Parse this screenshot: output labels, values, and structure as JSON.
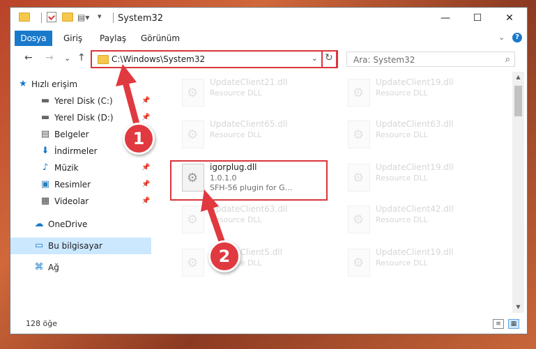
{
  "window": {
    "title": "System32",
    "controls": {
      "minimize": "—",
      "maximize": "☐",
      "close": "✕"
    }
  },
  "ribbon": {
    "tabs": [
      "Dosya",
      "Giriş",
      "Paylaş",
      "Görünüm"
    ],
    "expand": "⌄",
    "help": "?"
  },
  "nav": {
    "back": "←",
    "forward": "→",
    "recent": "⌄",
    "up": "↑",
    "address": "C:\\Windows\\System32",
    "address_dropdown": "⌄",
    "refresh": "↻",
    "search_placeholder": "Ara: System32",
    "search_glyph": "⌕"
  },
  "sidebar": {
    "items": [
      {
        "label": "Hızlı erişim",
        "icon": "star-icon",
        "glyph": "★",
        "pinned": false
      },
      {
        "label": "Yerel Disk (C:)",
        "icon": "drive-icon",
        "glyph": "▬",
        "pinned": true
      },
      {
        "label": "Yerel Disk (D:)",
        "icon": "drive-icon",
        "glyph": "▬",
        "pinned": true
      },
      {
        "label": "Belgeler",
        "icon": "document-icon",
        "glyph": "▤",
        "pinned": true
      },
      {
        "label": "İndirmeler",
        "icon": "download-icon",
        "glyph": "⬇",
        "pinned": true
      },
      {
        "label": "Müzik",
        "icon": "music-icon",
        "glyph": "♪",
        "pinned": true
      },
      {
        "label": "Resimler",
        "icon": "pictures-icon",
        "glyph": "▣",
        "pinned": true
      },
      {
        "label": "Videolar",
        "icon": "video-icon",
        "glyph": "▦",
        "pinned": true
      },
      {
        "label": "OneDrive",
        "icon": "cloud-icon",
        "glyph": "☁",
        "pinned": false
      },
      {
        "label": "Bu bilgisayar",
        "icon": "computer-icon",
        "glyph": "▭",
        "pinned": false
      },
      {
        "label": "Ağ",
        "icon": "network-icon",
        "glyph": "⌘",
        "pinned": false
      }
    ],
    "pin_glyph": "📌"
  },
  "files": {
    "left_column": [
      {
        "name": "UpdateClient21.dll",
        "line2": "Resource DLL",
        "line3": ""
      },
      {
        "name": "UpdateClient65.dll",
        "line2": "Resource DLL",
        "line3": ""
      },
      {
        "name": "igorplug.dll",
        "line2": "1.0.1.0",
        "line3": "SFH-56 plugin for G..."
      },
      {
        "name": "UpdateClient63.dll",
        "line2": "Resource DLL",
        "line3": ""
      },
      {
        "name": "UpdateClient5.dll",
        "line2": "Resource DLL",
        "line3": ""
      }
    ],
    "right_column": [
      {
        "name": "UpdateClient19.dll",
        "line2": "Resource DLL"
      },
      {
        "name": "UpdateClient63.dll",
        "line2": "Resource DLL"
      },
      {
        "name": "UpdateClient19.dll",
        "line2": "Resource DLL"
      },
      {
        "name": "UpdateClient42.dll",
        "line2": "Resource DLL"
      },
      {
        "name": "UpdateClient19.dll",
        "line2": "Resource DLL"
      }
    ]
  },
  "status": {
    "count": "128 öğe"
  },
  "callouts": {
    "step1": "1",
    "step2": "2",
    "color": "#e0393f"
  }
}
